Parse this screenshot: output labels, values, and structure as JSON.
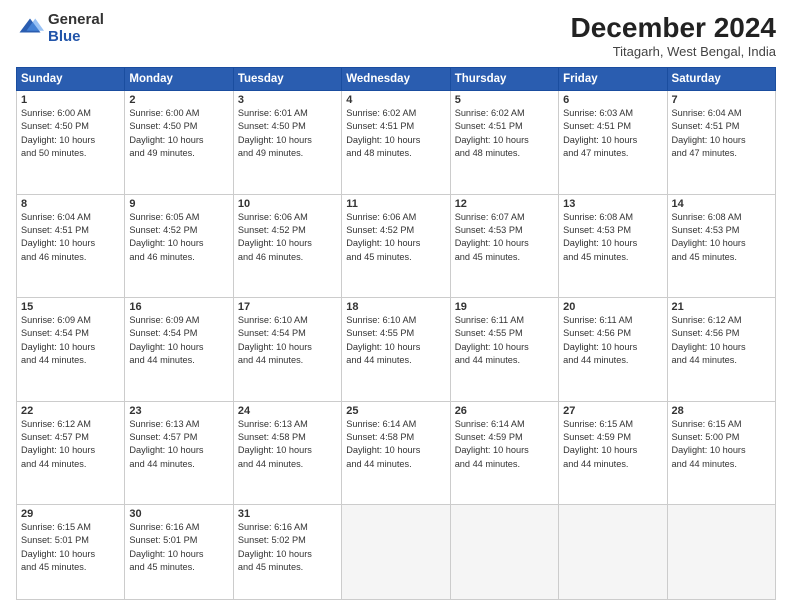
{
  "logo": {
    "general": "General",
    "blue": "Blue"
  },
  "title": "December 2024",
  "subtitle": "Titagarh, West Bengal, India",
  "headers": [
    "Sunday",
    "Monday",
    "Tuesday",
    "Wednesday",
    "Thursday",
    "Friday",
    "Saturday"
  ],
  "weeks": [
    [
      {
        "day": "1",
        "rise": "Sunrise: 6:00 AM",
        "set": "Sunset: 4:50 PM",
        "day_text": "Daylight: 10 hours",
        "min_text": "and 50 minutes."
      },
      {
        "day": "2",
        "rise": "Sunrise: 6:00 AM",
        "set": "Sunset: 4:50 PM",
        "day_text": "Daylight: 10 hours",
        "min_text": "and 49 minutes."
      },
      {
        "day": "3",
        "rise": "Sunrise: 6:01 AM",
        "set": "Sunset: 4:50 PM",
        "day_text": "Daylight: 10 hours",
        "min_text": "and 49 minutes."
      },
      {
        "day": "4",
        "rise": "Sunrise: 6:02 AM",
        "set": "Sunset: 4:51 PM",
        "day_text": "Daylight: 10 hours",
        "min_text": "and 48 minutes."
      },
      {
        "day": "5",
        "rise": "Sunrise: 6:02 AM",
        "set": "Sunset: 4:51 PM",
        "day_text": "Daylight: 10 hours",
        "min_text": "and 48 minutes."
      },
      {
        "day": "6",
        "rise": "Sunrise: 6:03 AM",
        "set": "Sunset: 4:51 PM",
        "day_text": "Daylight: 10 hours",
        "min_text": "and 47 minutes."
      },
      {
        "day": "7",
        "rise": "Sunrise: 6:04 AM",
        "set": "Sunset: 4:51 PM",
        "day_text": "Daylight: 10 hours",
        "min_text": "and 47 minutes."
      }
    ],
    [
      {
        "day": "8",
        "rise": "Sunrise: 6:04 AM",
        "set": "Sunset: 4:51 PM",
        "day_text": "Daylight: 10 hours",
        "min_text": "and 46 minutes."
      },
      {
        "day": "9",
        "rise": "Sunrise: 6:05 AM",
        "set": "Sunset: 4:52 PM",
        "day_text": "Daylight: 10 hours",
        "min_text": "and 46 minutes."
      },
      {
        "day": "10",
        "rise": "Sunrise: 6:06 AM",
        "set": "Sunset: 4:52 PM",
        "day_text": "Daylight: 10 hours",
        "min_text": "and 46 minutes."
      },
      {
        "day": "11",
        "rise": "Sunrise: 6:06 AM",
        "set": "Sunset: 4:52 PM",
        "day_text": "Daylight: 10 hours",
        "min_text": "and 45 minutes."
      },
      {
        "day": "12",
        "rise": "Sunrise: 6:07 AM",
        "set": "Sunset: 4:53 PM",
        "day_text": "Daylight: 10 hours",
        "min_text": "and 45 minutes."
      },
      {
        "day": "13",
        "rise": "Sunrise: 6:08 AM",
        "set": "Sunset: 4:53 PM",
        "day_text": "Daylight: 10 hours",
        "min_text": "and 45 minutes."
      },
      {
        "day": "14",
        "rise": "Sunrise: 6:08 AM",
        "set": "Sunset: 4:53 PM",
        "day_text": "Daylight: 10 hours",
        "min_text": "and 45 minutes."
      }
    ],
    [
      {
        "day": "15",
        "rise": "Sunrise: 6:09 AM",
        "set": "Sunset: 4:54 PM",
        "day_text": "Daylight: 10 hours",
        "min_text": "and 44 minutes."
      },
      {
        "day": "16",
        "rise": "Sunrise: 6:09 AM",
        "set": "Sunset: 4:54 PM",
        "day_text": "Daylight: 10 hours",
        "min_text": "and 44 minutes."
      },
      {
        "day": "17",
        "rise": "Sunrise: 6:10 AM",
        "set": "Sunset: 4:54 PM",
        "day_text": "Daylight: 10 hours",
        "min_text": "and 44 minutes."
      },
      {
        "day": "18",
        "rise": "Sunrise: 6:10 AM",
        "set": "Sunset: 4:55 PM",
        "day_text": "Daylight: 10 hours",
        "min_text": "and 44 minutes."
      },
      {
        "day": "19",
        "rise": "Sunrise: 6:11 AM",
        "set": "Sunset: 4:55 PM",
        "day_text": "Daylight: 10 hours",
        "min_text": "and 44 minutes."
      },
      {
        "day": "20",
        "rise": "Sunrise: 6:11 AM",
        "set": "Sunset: 4:56 PM",
        "day_text": "Daylight: 10 hours",
        "min_text": "and 44 minutes."
      },
      {
        "day": "21",
        "rise": "Sunrise: 6:12 AM",
        "set": "Sunset: 4:56 PM",
        "day_text": "Daylight: 10 hours",
        "min_text": "and 44 minutes."
      }
    ],
    [
      {
        "day": "22",
        "rise": "Sunrise: 6:12 AM",
        "set": "Sunset: 4:57 PM",
        "day_text": "Daylight: 10 hours",
        "min_text": "and 44 minutes."
      },
      {
        "day": "23",
        "rise": "Sunrise: 6:13 AM",
        "set": "Sunset: 4:57 PM",
        "day_text": "Daylight: 10 hours",
        "min_text": "and 44 minutes."
      },
      {
        "day": "24",
        "rise": "Sunrise: 6:13 AM",
        "set": "Sunset: 4:58 PM",
        "day_text": "Daylight: 10 hours",
        "min_text": "and 44 minutes."
      },
      {
        "day": "25",
        "rise": "Sunrise: 6:14 AM",
        "set": "Sunset: 4:58 PM",
        "day_text": "Daylight: 10 hours",
        "min_text": "and 44 minutes."
      },
      {
        "day": "26",
        "rise": "Sunrise: 6:14 AM",
        "set": "Sunset: 4:59 PM",
        "day_text": "Daylight: 10 hours",
        "min_text": "and 44 minutes."
      },
      {
        "day": "27",
        "rise": "Sunrise: 6:15 AM",
        "set": "Sunset: 4:59 PM",
        "day_text": "Daylight: 10 hours",
        "min_text": "and 44 minutes."
      },
      {
        "day": "28",
        "rise": "Sunrise: 6:15 AM",
        "set": "Sunset: 5:00 PM",
        "day_text": "Daylight: 10 hours",
        "min_text": "and 44 minutes."
      }
    ],
    [
      {
        "day": "29",
        "rise": "Sunrise: 6:15 AM",
        "set": "Sunset: 5:01 PM",
        "day_text": "Daylight: 10 hours",
        "min_text": "and 45 minutes."
      },
      {
        "day": "30",
        "rise": "Sunrise: 6:16 AM",
        "set": "Sunset: 5:01 PM",
        "day_text": "Daylight: 10 hours",
        "min_text": "and 45 minutes."
      },
      {
        "day": "31",
        "rise": "Sunrise: 6:16 AM",
        "set": "Sunset: 5:02 PM",
        "day_text": "Daylight: 10 hours",
        "min_text": "and 45 minutes."
      },
      null,
      null,
      null,
      null
    ]
  ]
}
